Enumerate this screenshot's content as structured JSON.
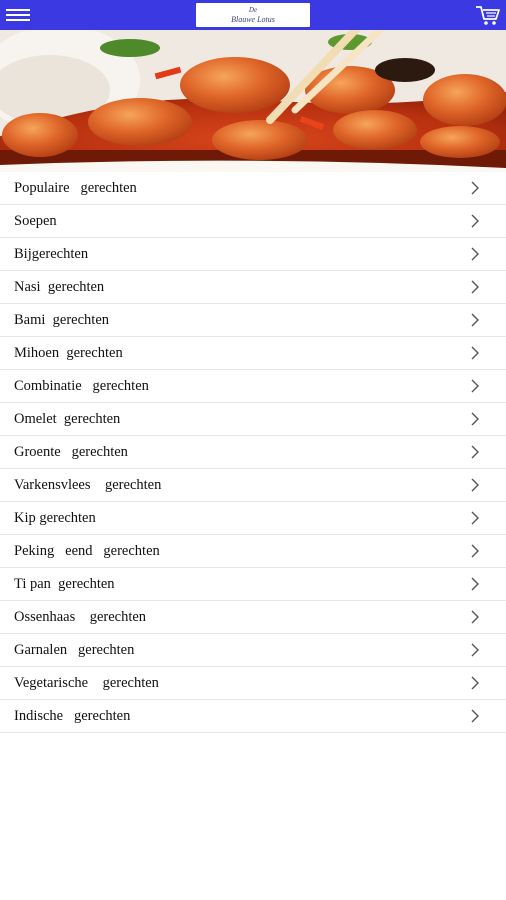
{
  "header": {
    "logo_line1": "De",
    "logo_line2": "Blauwe Lotus"
  },
  "icons": {
    "menu": "hamburger-menu-icon",
    "cart": "shopping-cart-icon",
    "row": "chevron-right-icon"
  },
  "colors": {
    "topbar": "#3b39e2"
  },
  "categories": [
    "Populaire   gerechten",
    "Soepen",
    "Bijgerechten",
    "Nasi  gerechten",
    "Bami  gerechten",
    "Mihoen  gerechten",
    "Combinatie   gerechten",
    "Omelet  gerechten",
    "Groente   gerechten",
    "Varkensvlees    gerechten",
    "Kip gerechten",
    "Peking   eend   gerechten",
    "Ti pan  gerechten",
    "Ossenhaas    gerechten",
    "Garnalen   gerechten",
    "Vegetarische    gerechten",
    "Indische   gerechten"
  ]
}
